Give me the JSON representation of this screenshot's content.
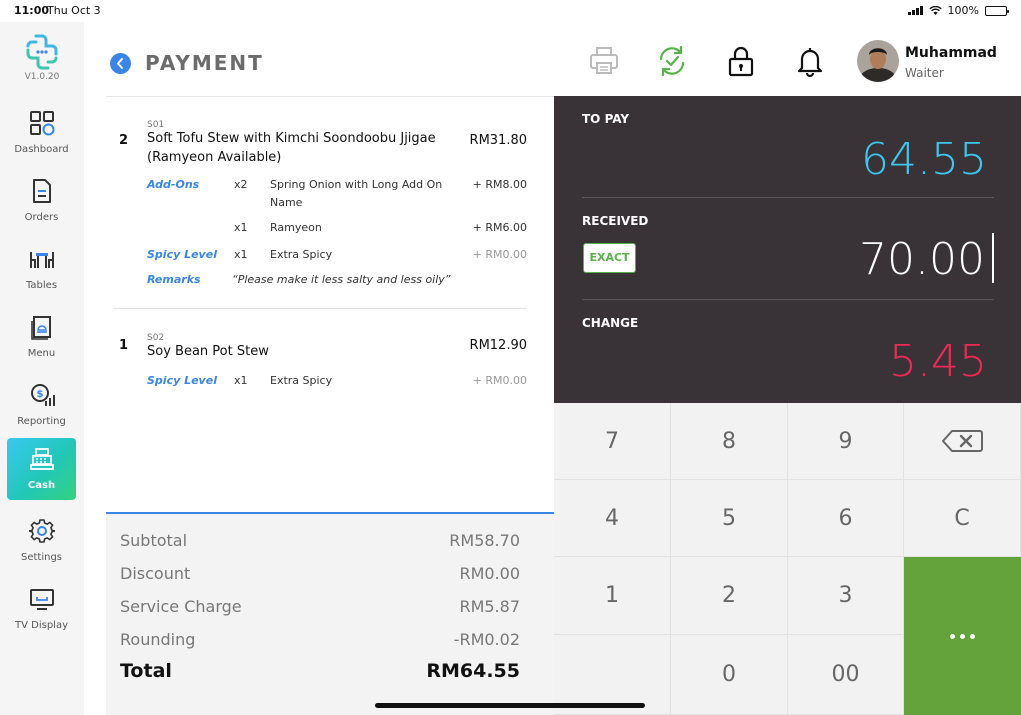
{
  "status_bar": {
    "time": "11:00",
    "date": "Thu Oct 3",
    "battery": "100%"
  },
  "sidebar": {
    "version": "V1.0.20",
    "items": [
      {
        "label": "Dashboard",
        "icon": "dashboard-icon"
      },
      {
        "label": "Orders",
        "icon": "orders-icon"
      },
      {
        "label": "Tables",
        "icon": "tables-icon"
      },
      {
        "label": "Menu",
        "icon": "menu-icon"
      },
      {
        "label": "Reporting",
        "icon": "reporting-icon"
      },
      {
        "label": "Cash",
        "icon": "cash-register-icon",
        "active": true
      },
      {
        "label": "Settings",
        "icon": "gear-icon"
      },
      {
        "label": "TV Display",
        "icon": "tv-icon"
      }
    ]
  },
  "header": {
    "title": "PAYMENT",
    "user": {
      "name": "Muhammad",
      "role": "Waiter"
    }
  },
  "orders": [
    {
      "qty": "2",
      "code": "S01",
      "name": "Soft Tofu Stew with Kimchi Soondoobu Jjigae (Ramyeon Available)",
      "price": "RM31.80",
      "addons_label": "Add-Ons",
      "addons": [
        {
          "qty": "x2",
          "name": "Spring Onion with Long Add On Name",
          "price": "+ RM8.00"
        },
        {
          "qty": "x1",
          "name": "Ramyeon",
          "price": "+ RM6.00"
        }
      ],
      "spicy_label": "Spicy Level",
      "spicy": {
        "qty": "x1",
        "name": "Extra Spicy",
        "price": "+ RM0.00"
      },
      "remarks_label": "Remarks",
      "remarks": "“Please make it less salty and less oily”"
    },
    {
      "qty": "1",
      "code": "S02",
      "name": "Soy Bean Pot Stew",
      "price": "RM12.90",
      "spicy_label": "Spicy Level",
      "spicy": {
        "qty": "x1",
        "name": "Extra Spicy",
        "price": "+ RM0.00"
      }
    }
  ],
  "totals": {
    "subtotal_label": "Subtotal",
    "subtotal": "RM58.70",
    "discount_label": "Discount",
    "discount": "RM0.00",
    "service_label": "Service Charge",
    "service": "RM5.87",
    "rounding_label": "Rounding",
    "rounding": "-RM0.02",
    "total_label": "Total",
    "total": "RM64.55"
  },
  "payment": {
    "to_pay_label": "TO PAY",
    "to_pay": "64.55",
    "received_label": "RECEIVED",
    "received": "70.00",
    "exact_label": "EXACT",
    "change_label": "CHANGE",
    "change": "5.45"
  },
  "keypad": {
    "k7": "7",
    "k8": "8",
    "k9": "9",
    "k4": "4",
    "k5": "5",
    "k6": "6",
    "clear": "C",
    "k1": "1",
    "k2": "2",
    "k3": "3",
    "k0": "0",
    "k00": "00"
  },
  "colors": {
    "accent_blue": "#3a86e8",
    "to_pay": "#3ec8ee",
    "received": "#ffffff",
    "change": "#ee2a54",
    "exact_green": "#58b24a",
    "confirm_green": "#64a23c",
    "panel_dark": "#393237"
  }
}
